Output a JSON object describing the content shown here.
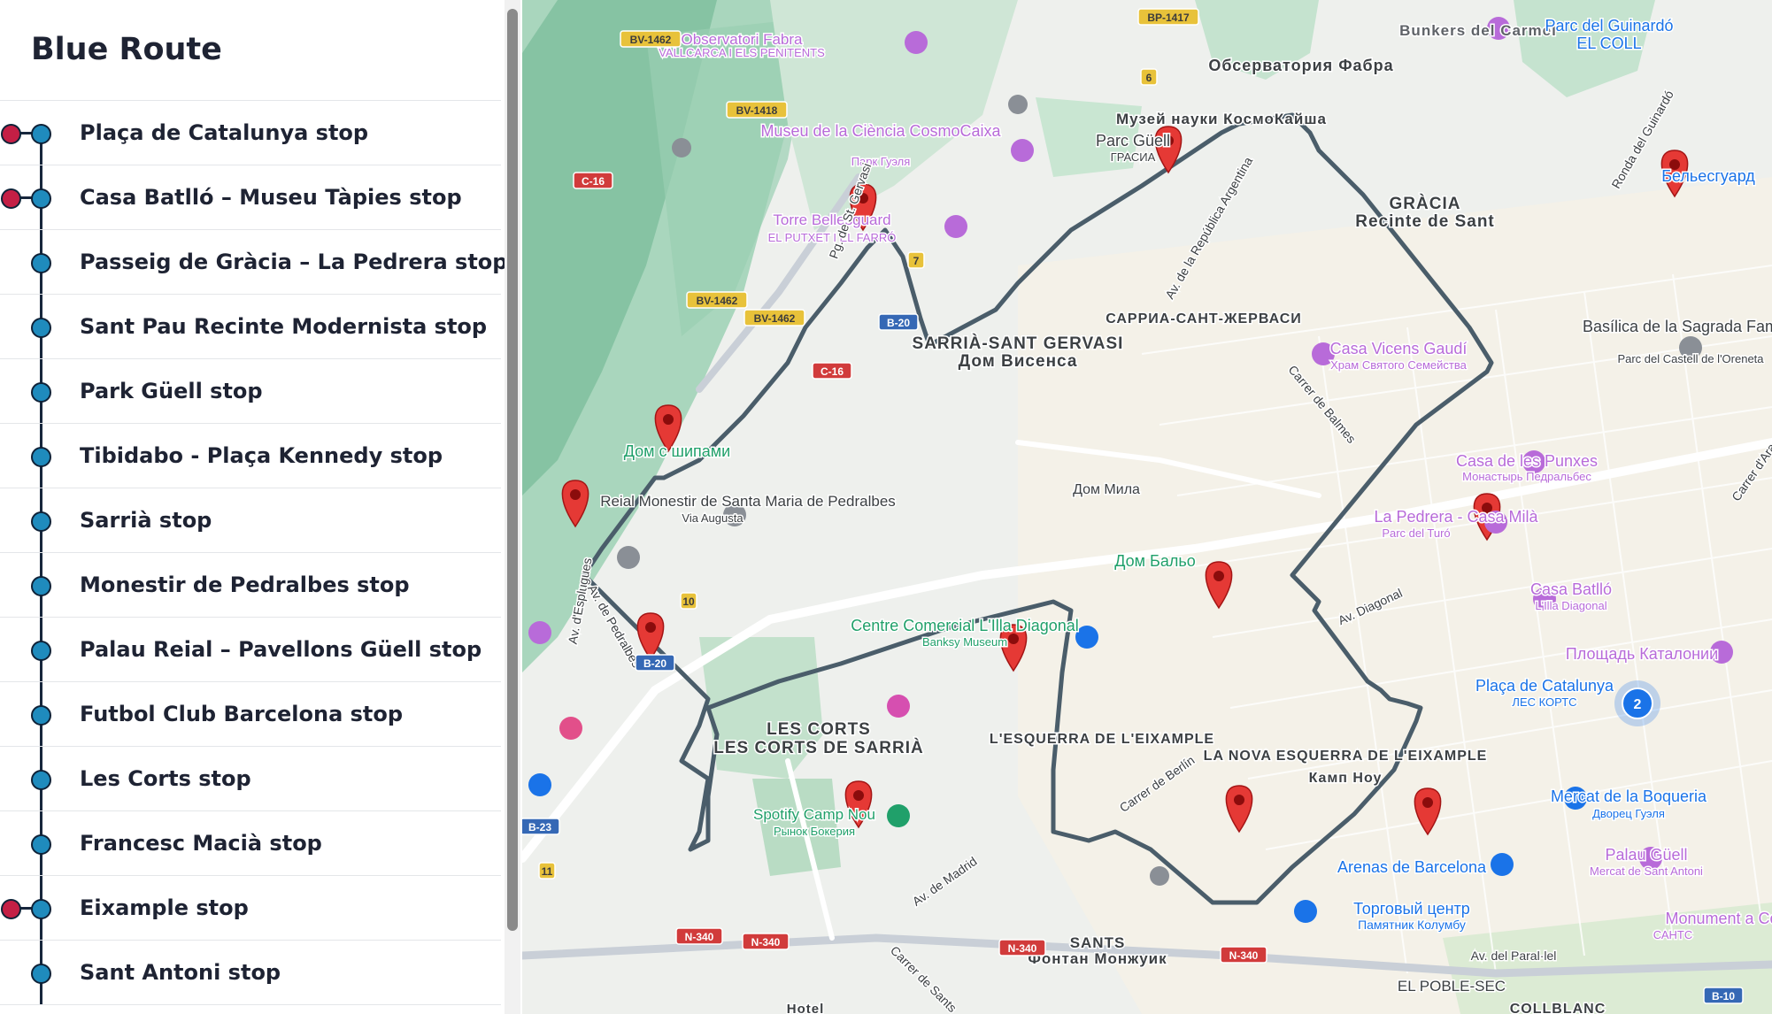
{
  "sidebar": {
    "title": "Blue Route",
    "stops": [
      {
        "label": "Plaça de Catalunya stop",
        "alert": true
      },
      {
        "label": "Casa Batlló – Museu Tàpies stop",
        "alert": true
      },
      {
        "label": "Passeig de Gràcia – La Pedrera stop",
        "alert": false
      },
      {
        "label": "Sant Pau Recinte Modernista stop",
        "alert": false
      },
      {
        "label": "Park Güell stop",
        "alert": false
      },
      {
        "label": "Tibidabo - Plaça Kennedy stop",
        "alert": false
      },
      {
        "label": "Sarrià stop",
        "alert": false
      },
      {
        "label": "Monestir de Pedralbes stop",
        "alert": false
      },
      {
        "label": "Palau Reial – Pavellons Güell stop",
        "alert": false
      },
      {
        "label": "Futbol Club Barcelona stop",
        "alert": false
      },
      {
        "label": "Les Corts stop",
        "alert": false
      },
      {
        "label": "Francesc Macià stop",
        "alert": false
      },
      {
        "label": "Eixample stop",
        "alert": true
      },
      {
        "label": "Sant Antoni stop",
        "alert": false
      }
    ]
  },
  "map": {
    "cluster_count": "2",
    "colors": {
      "route": "#4a5d6a",
      "marker": "#e53935",
      "cluster": "#1a73e8",
      "poi": "#b86bd9"
    },
    "places": [
      {
        "name": "Bunkers del Carmel"
      },
      {
        "name": "Parc del Guinardó"
      },
      {
        "name": "EL COLL"
      },
      {
        "name": "Обсерватория Фабра"
      },
      {
        "name": "Observatori Fabra"
      },
      {
        "name": "VALLCARCA I ELS PENITENTS"
      },
      {
        "name": "Музей науки КосмоКайша"
      },
      {
        "name": "Museu de la Ciència CosmoCaixa"
      },
      {
        "name": "Парк Гуэля"
      },
      {
        "name": "Parc Güell"
      },
      {
        "name": "ГРАСИА"
      },
      {
        "name": "GRÀCIA"
      },
      {
        "name": "Recinte de Sant"
      },
      {
        "name": "Бельесгуард"
      },
      {
        "name": "Torre Bellesguard"
      },
      {
        "name": "EL PUTXET I EL FARRÓ"
      },
      {
        "name": "САРРИА-САНТ-ЖЕРВАСИ"
      },
      {
        "name": "SARRIÀ-SANT GERVASI"
      },
      {
        "name": "Дом Висенса"
      },
      {
        "name": "Casa Vicens Gaudí"
      },
      {
        "name": "Храм Святого Семейства"
      },
      {
        "name": "Basílica de la Sagrada Família"
      },
      {
        "name": "Parc del Castell de l'Oreneta"
      },
      {
        "name": "Дом с шипами"
      },
      {
        "name": "Casa de les Punxes"
      },
      {
        "name": "Монастырь Педральбес"
      },
      {
        "name": "Reial Monestir de Santa Maria de Pedralbes"
      },
      {
        "name": "Via Augusta"
      },
      {
        "name": "Дом Мила"
      },
      {
        "name": "La Pedrera - Casa Milà"
      },
      {
        "name": "Parc del Turó"
      },
      {
        "name": "Дом Бальо"
      },
      {
        "name": "Casa Batlló"
      },
      {
        "name": "L'Illa Diagonal"
      },
      {
        "name": "Centre Comercial L'Illa Diagonal"
      },
      {
        "name": "Banksy Museum"
      },
      {
        "name": "Площадь Каталонии"
      },
      {
        "name": "Plaça de Catalunya"
      },
      {
        "name": "ЛЕС КОРТС"
      },
      {
        "name": "LES CORTS"
      },
      {
        "name": "LES CORTS DE SARRIÀ"
      },
      {
        "name": "L'ESQUERRA DE L'EIXAMPLE"
      },
      {
        "name": "LA NOVA ESQUERRA DE L'EIXAMPLE"
      },
      {
        "name": "Камп Ноу"
      },
      {
        "name": "Spotify Camp Nou"
      },
      {
        "name": "Рынок Бокерия"
      },
      {
        "name": "Mercat de la Boqueria"
      },
      {
        "name": "Дворец Гуэля"
      },
      {
        "name": "Palau Güell"
      },
      {
        "name": "Mercat de Sant Antoni"
      },
      {
        "name": "Arenas de Barcelona"
      },
      {
        "name": "Торговый центр"
      },
      {
        "name": "Памятник Колумбу"
      },
      {
        "name": "Monument a Colom"
      },
      {
        "name": "САНТС"
      },
      {
        "name": "SANTS"
      },
      {
        "name": "Фонтан Монжуик"
      },
      {
        "name": "EL POBLE-SEC"
      },
      {
        "name": "COLLBLANC"
      },
      {
        "name": "Hotel"
      }
    ],
    "streets": [
      {
        "name": "Av. de la República Argentina"
      },
      {
        "name": "Carrer de Balmes"
      },
      {
        "name": "Ronda del Guinardó"
      },
      {
        "name": "Av. Diagonal"
      },
      {
        "name": "Carrer de Berlín"
      },
      {
        "name": "Av. de Madrid"
      },
      {
        "name": "Av. del Paral·lel"
      },
      {
        "name": "Carrer d'Aragó"
      },
      {
        "name": "Av. d'Esplugues"
      },
      {
        "name": "Av. de Pedralbes"
      },
      {
        "name": "Pg. de St. Gervasi"
      },
      {
        "name": "Carrer de Sants"
      }
    ],
    "roads": [
      "BV-1462",
      "BV-1418",
      "BP-1417",
      "C-16",
      "B-20",
      "BV-1462",
      "BV-1462",
      "C-16",
      "B-20",
      "B-23",
      "N-340",
      "N-340",
      "N-340",
      "N-340",
      "B-10",
      "10",
      "11",
      "6",
      "7"
    ]
  }
}
